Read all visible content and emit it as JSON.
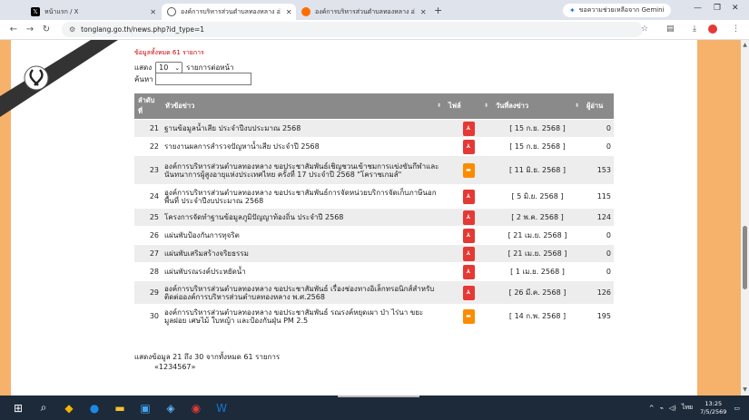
{
  "browser": {
    "tabs": [
      {
        "label": "หน้าแรก / X",
        "favicon": "x-logo-icon",
        "active": false
      },
      {
        "label": "องค์การบริหารส่วนตำบลทองหลาง อ่",
        "favicon": "site-icon",
        "active": true
      },
      {
        "label": "องค์การบริหารส่วนตำบลทองหลาง อ่",
        "favicon": "site-icon",
        "active": false
      }
    ],
    "gemini_label": "ขอความช่วยเหลือจาก Gemini",
    "url": "tonglang.go.th/news.php?id_type=1"
  },
  "page": {
    "total_label": "ข้อมูลทั้งหมด 61 รายการ",
    "show_prefix": "แสดง",
    "show_value": "10",
    "show_suffix": "รายการต่อหน้า",
    "search_label": "ค้นหา",
    "table": {
      "headers": {
        "no": "ลำดับที่",
        "title": "หัวข้อข่าว",
        "file": "ไฟล์",
        "date": "วันที่ลงข่าว",
        "reads": "ผู้อ่าน"
      },
      "rows": [
        {
          "no": "21",
          "title": "ฐานข้อมูลน้ำเสีย ประจำปีงบประมาณ 2568",
          "file": "pdf",
          "date": "[ 15 ก.ย. 2568 ]",
          "reads": "0"
        },
        {
          "no": "22",
          "title": "รายงานผลการสำรวจปัญหาน้ำเสีย ประจำปี 2568",
          "file": "pdf",
          "date": "[ 15 ก.ย. 2568 ]",
          "reads": "0"
        },
        {
          "no": "23",
          "title": "องค์การบริหารส่วนตำบลทองหลาง ขอประชาสัมพันธ์เชิญชวนเข้าชมการแข่งขันกีฬาและนันทนาการผู้สูงอายุแห่งประเทศไทย ครั้งที่ 17 ประจำปี 2568 \"โคราชเกมส์\"",
          "file": "img",
          "date": "[ 11 มิ.ย. 2568 ]",
          "reads": "153"
        },
        {
          "no": "24",
          "title": "องค์การบริหารส่วนตำบลทองหลาง ขอประชาสัมพันธ์การจัดหน่วยบริการจัดเก็บภาษีนอกพื้นที่ ประจำปีงบประมาณ 2568",
          "file": "pdf",
          "date": "[ 5 มิ.ย. 2568 ]",
          "reads": "115"
        },
        {
          "no": "25",
          "title": "โครงการจัดทำฐานข้อมูลภูมิปัญญาท้องถิ่น ประจำปี 2568",
          "file": "pdf",
          "date": "[ 2 พ.ค. 2568 ]",
          "reads": "124"
        },
        {
          "no": "26",
          "title": "แผ่นพับป้องกันการทุจริต",
          "file": "pdf",
          "date": "[ 21 เม.ย. 2568 ]",
          "reads": "0"
        },
        {
          "no": "27",
          "title": "แผ่นพับเสริมสร้างจริยธรรม",
          "file": "pdf",
          "date": "[ 21 เม.ย. 2568 ]",
          "reads": "0"
        },
        {
          "no": "28",
          "title": "แผ่นพับรณรงค์ประหยัดน้ำ",
          "file": "pdf",
          "date": "[ 1 เม.ย. 2568 ]",
          "reads": "0"
        },
        {
          "no": "29",
          "title": "องค์การบริหารส่วนตำบลทองหลาง ขอประชาสัมพันธ์ เรื่องช่องทางอิเล็กทรอนิกส์สำหรับติดต่อองค์การบริหารส่วนตำบลทองหลาง พ.ศ.2568",
          "file": "pdf",
          "date": "[ 26 มี.ค. 2568 ]",
          "reads": "126"
        },
        {
          "no": "30",
          "title": "องค์การบริหารส่วนตำบลทองหลาง ขอประชาสัมพันธ์ รณรงค์หยุดเผา ป่า ไร่นา ขยะมูลฝอย เศษไม้ ใบหญ้า และป้องกันฝุ่น PM 2.5",
          "file": "img",
          "date": "[ 14 ก.พ. 2568 ]",
          "reads": "195"
        }
      ]
    },
    "footer_info": "แสดงข้อมูล 21 ถึง 30 จากทั้งหมด 61 รายการ",
    "pager": "«1234567»"
  },
  "taskbar": {
    "time": "13:25",
    "date": "7/5/2569",
    "lang": "ไทย"
  },
  "colors": {
    "header_bg": "#8a8a8a",
    "side_orange": "#f6b26b",
    "pdf_red": "#e53935",
    "img_orange": "#fb8c00"
  }
}
